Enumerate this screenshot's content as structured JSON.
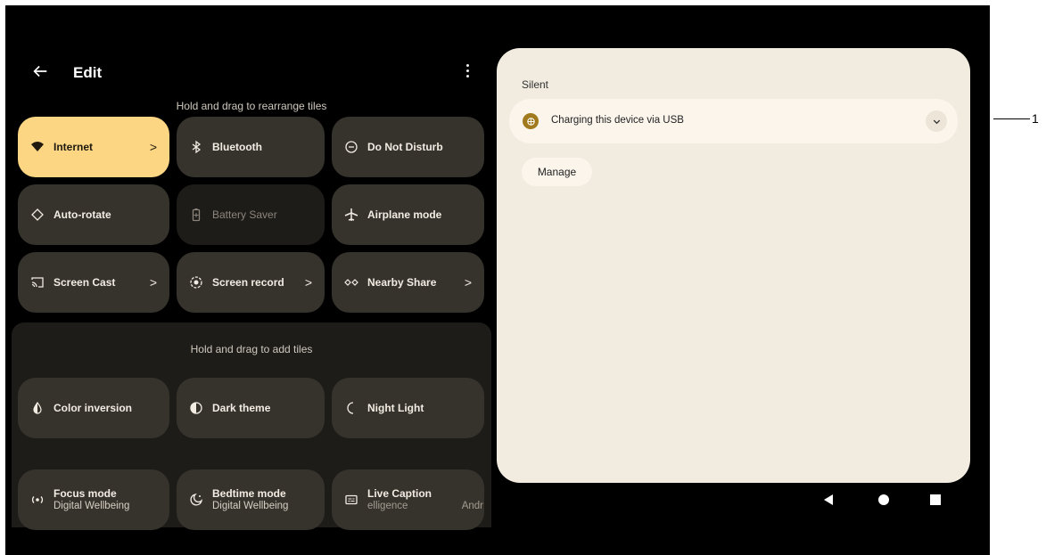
{
  "edit": {
    "title": "Edit",
    "rearrange_hint": "Hold and drag to rearrange tiles",
    "add_hint": "Hold and drag to add tiles"
  },
  "active_tiles": [
    {
      "label": "Internet",
      "chevron": ">",
      "icon": "wifi-icon",
      "state": "on"
    },
    {
      "label": "Bluetooth",
      "icon": "bluetooth-icon",
      "state": "off"
    },
    {
      "label": "Do Not Disturb",
      "icon": "dnd-icon",
      "state": "off"
    },
    {
      "label": "Auto-rotate",
      "icon": "rotate-icon",
      "state": "off"
    },
    {
      "label": "Battery Saver",
      "icon": "battery-icon",
      "state": "unavailable"
    },
    {
      "label": "Airplane mode",
      "icon": "airplane-icon",
      "state": "off"
    },
    {
      "label": "Screen Cast",
      "chevron": ">",
      "icon": "cast-icon",
      "state": "off"
    },
    {
      "label": "Screen record",
      "chevron": ">",
      "icon": "record-icon",
      "state": "off"
    },
    {
      "label": "Nearby Share",
      "chevron": ">",
      "icon": "nearby-share-icon",
      "state": "off"
    }
  ],
  "available_tiles": [
    {
      "label": "Color inversion",
      "icon": "color-inversion-icon"
    },
    {
      "label": "Dark theme",
      "icon": "dark-theme-icon"
    },
    {
      "label": "Night Light",
      "icon": "night-light-icon"
    },
    {
      "label": "Focus mode",
      "sub": "Digital Wellbeing",
      "icon": "focus-mode-icon"
    },
    {
      "label": "Bedtime mode",
      "sub": "Digital Wellbeing",
      "icon": "bedtime-icon"
    },
    {
      "label": "Live Caption",
      "sub": "elligence",
      "sub2": "Andr",
      "icon": "caption-icon"
    }
  ],
  "notifications": {
    "section_label": "Silent",
    "item_text": "Charging this device via USB",
    "manage_label": "Manage"
  },
  "callout": "1",
  "colors": {
    "active_tile": "#fcd682",
    "tile": "#36322c",
    "panel": "#f1ebe0"
  }
}
